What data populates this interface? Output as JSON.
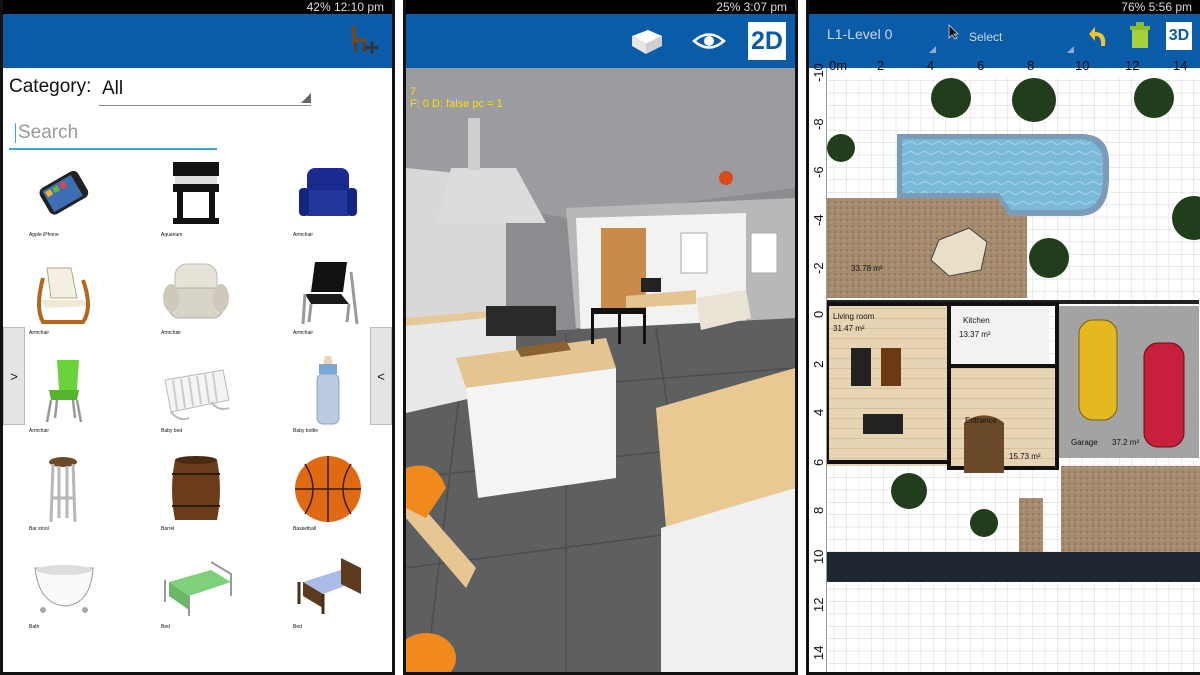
{
  "panel1": {
    "status_text": "42% 12:10 pm",
    "category_label": "Category:",
    "category_value": "All",
    "search_placeholder": "Search",
    "left_tab": ">",
    "right_tab": "<",
    "items": [
      {
        "label": "Apple iPhone",
        "icon": "phone-icon"
      },
      {
        "label": "Aquarium",
        "icon": "aquarium-icon"
      },
      {
        "label": "Armchair",
        "icon": "armchair-icon"
      },
      {
        "label": "Armchair",
        "icon": "armchair-icon"
      },
      {
        "label": "Armchair",
        "icon": "armchair-icon"
      },
      {
        "label": "Armchair",
        "icon": "armchair-icon"
      },
      {
        "label": "Armchair",
        "icon": "chair-icon"
      },
      {
        "label": "Baby bed",
        "icon": "crib-icon"
      },
      {
        "label": "Baby bottle",
        "icon": "bottle-icon"
      },
      {
        "label": "Bar stool",
        "icon": "stool-icon"
      },
      {
        "label": "Barrel",
        "icon": "barrel-icon"
      },
      {
        "label": "Basketball",
        "icon": "basketball-icon"
      },
      {
        "label": "Bath",
        "icon": "bathtub-icon"
      },
      {
        "label": "Bed",
        "icon": "bed-icon"
      },
      {
        "label": "Bed",
        "icon": "bed-icon"
      }
    ]
  },
  "panel2": {
    "status_text": "25% 3:07 pm",
    "debug_line1": "7",
    "debug_line2": "F: 0 D: false  pc = 1",
    "btn_2d": "2D"
  },
  "panel3": {
    "status_text": "76% 5:56 pm",
    "level": "L1-Level 0",
    "select_label": "Select",
    "btn_3d": "3D",
    "ruler_top": [
      "0m",
      "2",
      "4",
      "6",
      "8",
      "10",
      "12",
      "14"
    ],
    "ruler_left": [
      "-10",
      "-8",
      "-6",
      "-4",
      "-2",
      "0",
      "2",
      "4",
      "6",
      "8",
      "10",
      "12",
      "14"
    ],
    "rooms": [
      {
        "name": "Living room",
        "area": "31.47 m²"
      },
      {
        "name": "Kitchen",
        "area": "13.37 m²"
      },
      {
        "name": "Entrance",
        "area": "15.73 m²"
      },
      {
        "name": "Garage",
        "area": "37.2 m²"
      },
      {
        "name": "",
        "area": "33.78 m²"
      }
    ]
  }
}
